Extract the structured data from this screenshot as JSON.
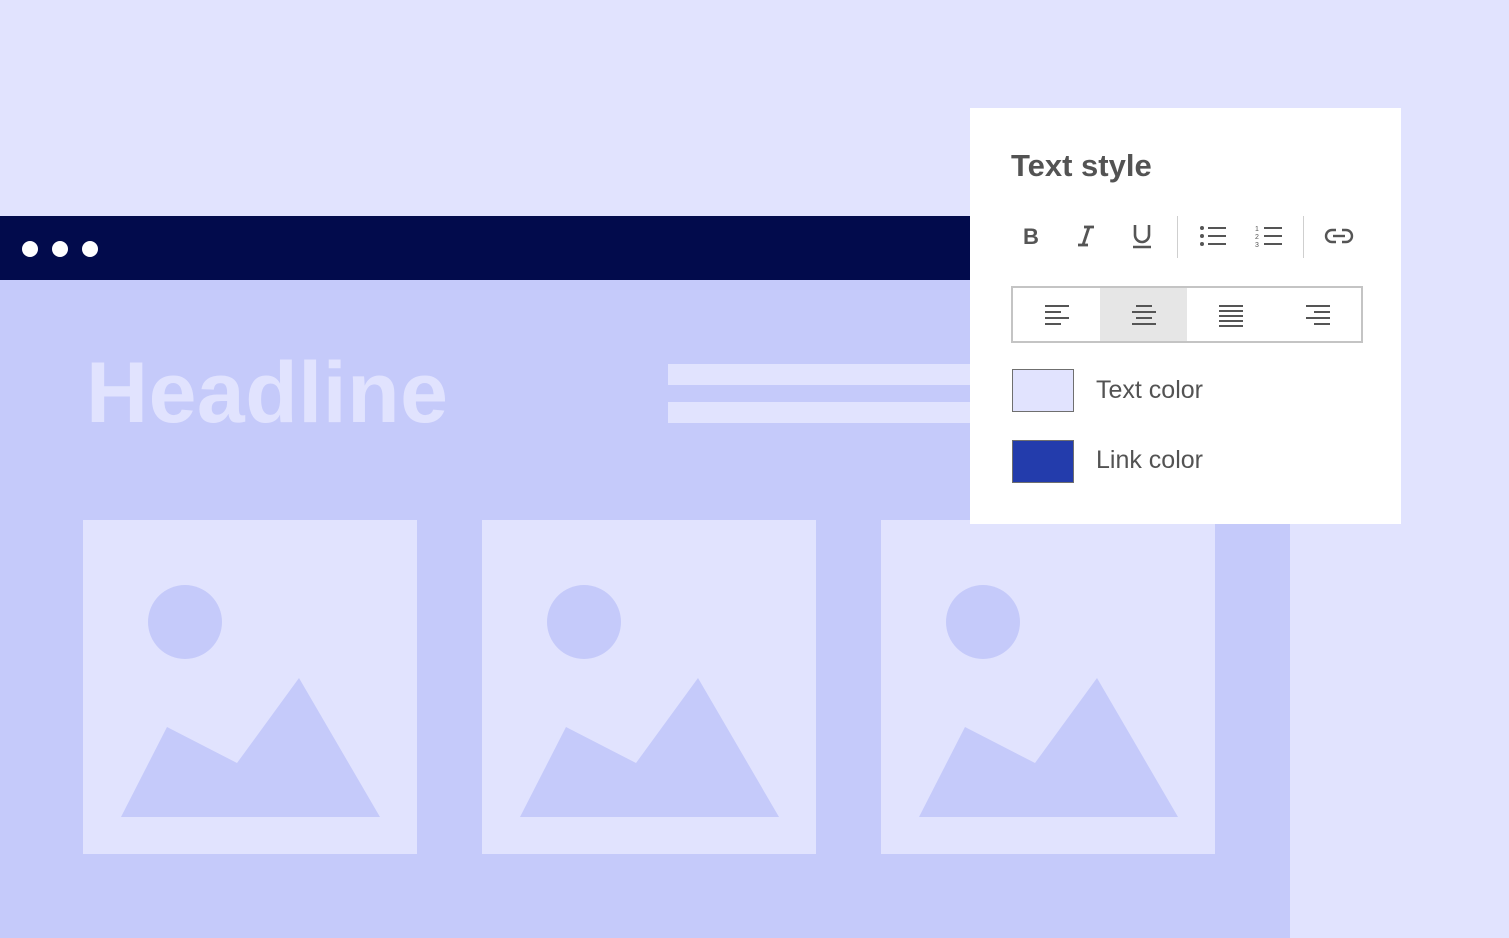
{
  "page": {
    "headline": "Headline"
  },
  "text_style_panel": {
    "title": "Text style",
    "formatting_buttons": [
      {
        "name": "bold",
        "icon": "bold-icon"
      },
      {
        "name": "italic",
        "icon": "italic-icon"
      },
      {
        "name": "underline",
        "icon": "underline-icon"
      },
      {
        "name": "bulleted-list",
        "icon": "bulleted-list-icon"
      },
      {
        "name": "numbered-list",
        "icon": "numbered-list-icon"
      },
      {
        "name": "link",
        "icon": "link-icon"
      }
    ],
    "alignment": {
      "options": [
        "left",
        "center",
        "justify",
        "right"
      ],
      "selected": "center"
    },
    "text_color": {
      "label": "Text color",
      "color": "#e1e3fe"
    },
    "link_color": {
      "label": "Link color",
      "color": "#233cac"
    }
  },
  "colors": {
    "background": "#e1e3fe",
    "browser_bar": "#020b4c",
    "browser_body": "#c5cafa",
    "panel": "#ffffff",
    "panel_text": "#535353"
  }
}
